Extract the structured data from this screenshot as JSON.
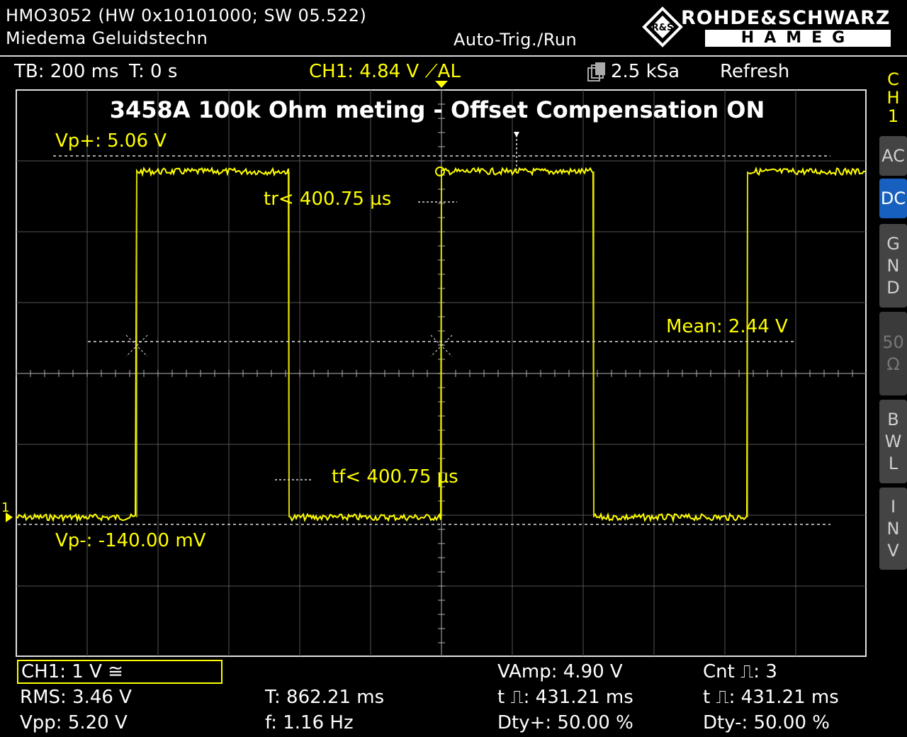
{
  "header": {
    "device": "HMO3052 (HW 0x10101000; SW 05.522)",
    "owner": "Miedema Geluidstechn",
    "trigger_mode": "Auto-Trig./Run",
    "brand_top": "ROHDE&SCHWARZ",
    "brand_bottom": "HAMEG"
  },
  "status_bar": {
    "timebase": "TB: 200 ms",
    "trigger_time": "T: 0 s",
    "channel_trigger": "CH1: 4.84 V ⟋AL",
    "sample_rate": "2.5 kSa",
    "refresh": "Refresh"
  },
  "screen": {
    "title": "3458A 100k Ohm meting - Offset Compensation ON",
    "vp_plus": "Vp+: 5.06 V",
    "vp_minus": "Vp-: -140.00 mV",
    "rise_time": "tr< 400.75 µs",
    "fall_time": "tf< 400.75 µs",
    "mean": "Mean: 2.44 V",
    "channel_marker": "1"
  },
  "side_panel": {
    "channel": [
      "C",
      "H",
      "1"
    ],
    "ac": "AC",
    "dc": "DC",
    "gnd": [
      "G",
      "N",
      "D"
    ],
    "fifty": "50",
    "ohm": "Ω",
    "bwl": [
      "B",
      "W",
      "L"
    ],
    "inv": [
      "I",
      "N",
      "V"
    ]
  },
  "bottom": {
    "channel_setting": "CH1: 1 V ≅",
    "rms": "RMS: 3.46 V",
    "vpp": "Vpp: 5.20 V",
    "period": "T: 862.21 ms",
    "frequency": "f: 1.16 Hz",
    "vamp": "VAmp: 4.90 V",
    "t_pos": "t ⎍: 431.21 ms",
    "duty_pos": "Dty+: 50.00 %",
    "count": "Cnt ⎍: 3",
    "t_neg": "t ⎍: 431.21 ms",
    "duty_neg": "Dty-: 50.00 %"
  },
  "colors": {
    "trace": "#ffff00",
    "grid": "#b0b0b0",
    "active_button": "#1860c0"
  }
}
